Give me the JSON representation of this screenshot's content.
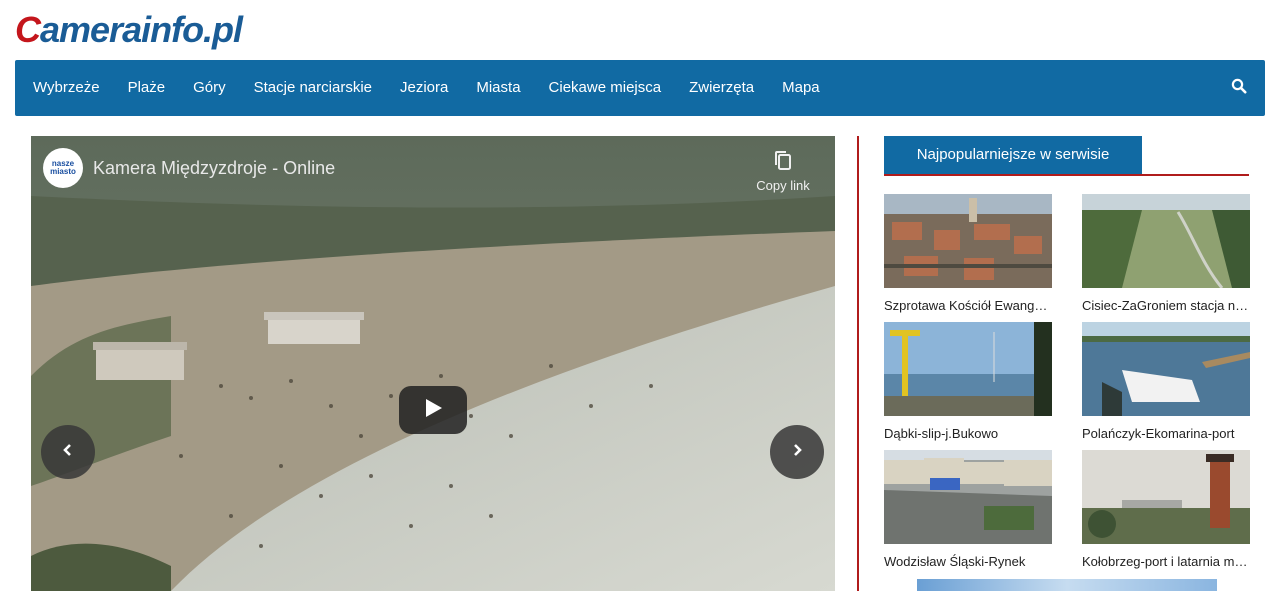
{
  "brand": {
    "logo_first": "C",
    "logo_rest": "amerainfo.pl",
    "color_primary": "#116aa3",
    "color_accent": "#b01c1c"
  },
  "nav": {
    "items": [
      "Wybrzeże",
      "Plaże",
      "Góry",
      "Stacje narciarskie",
      "Jeziora",
      "Miasta",
      "Ciekawe miejsca",
      "Zwierzęta",
      "Mapa"
    ],
    "search_icon": "search-icon"
  },
  "player": {
    "title": "Kamera Międzyzdroje - Online",
    "channel_logo_text": "nasze miasto",
    "copy_link_label": "Copy link",
    "icons": {
      "copy": "copy-icon",
      "play": "play-icon",
      "prev": "chevron-left-icon",
      "next": "chevron-right-icon"
    }
  },
  "sidebar": {
    "heading": "Najpopularniejsze w serwisie",
    "cards": [
      {
        "label": "Szprotawa Kościół Ewangelicki"
      },
      {
        "label": "Cisiec-ZaGroniem stacja narciarska"
      },
      {
        "label": "Dąbki-slip-j.Bukowo"
      },
      {
        "label": "Polańczyk-Ekomarina-port"
      },
      {
        "label": "Wodzisław Śląski-Rynek"
      },
      {
        "label": "Kołobrzeg-port i latarnia morska"
      }
    ]
  }
}
